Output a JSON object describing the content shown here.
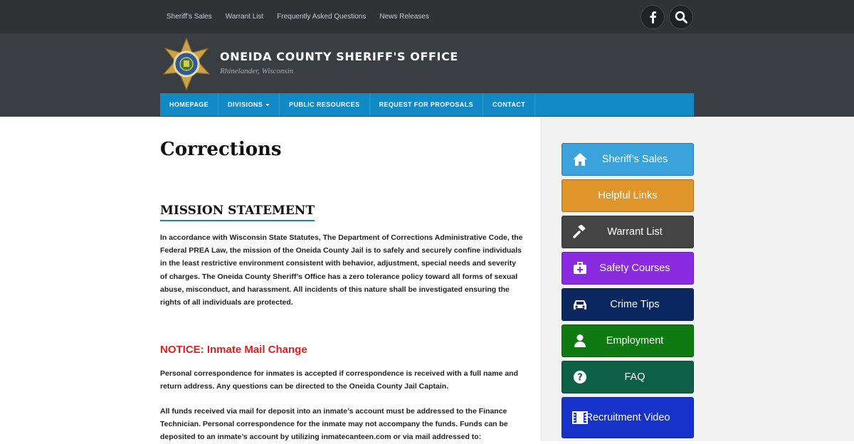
{
  "topbar": {
    "links": [
      "Sheriff’s Sales",
      "Warrant List",
      "Frequently Asked Questions",
      "News Releases"
    ],
    "icons": [
      "facebook-icon",
      "search-icon"
    ]
  },
  "header": {
    "title": "ONEIDA COUNTY SHERIFF'S OFFICE",
    "subtitle": "Rhinelander, Wisconsin",
    "logo_text": [
      "SHERIFF",
      "ONEIDA COUNTY"
    ]
  },
  "nav": {
    "items": [
      {
        "label": "HOMEPAGE"
      },
      {
        "label": "DIVISIONS"
      },
      {
        "label": "PUBLIC RESOURCES"
      },
      {
        "label": "REQUEST FOR PROPOSALS"
      },
      {
        "label": "CONTACT"
      }
    ]
  },
  "main": {
    "title": "Corrections",
    "mission_heading": "MISSION STATEMENT",
    "mission_text": "In accordance with Wisconsin State Statutes, The Department of Corrections Administrative Code, the Federal PREA Law,  the mission of the Oneida County Jail is to safely and securely confine individuals in the least restrictive environment consistent with behavior, adjustment, special needs and severity of charges. The Oneida County Sheriff’s Office has a zero tolerance policy toward all forms of sexual abuse, misconduct, and harassment.  All incidents of this nature shall be investigated ensuring the rights of all individuals are protected.",
    "notice_heading": "NOTICE: Inmate Mail Change",
    "notice_p1": "Personal correspondence for inmates is accepted if correspondence is received with a full name and return address.  Any questions can be directed to the Oneida County Jail Captain.",
    "notice_p2": "All funds received via mail for deposit into an inmate’s account must be addressed to the Finance Technician.  Personal correspondence for the inmate may not accompany the funds.  Funds can be deposited to an inmate’s account by utilizing inmatecanteen.com or via mail addressed to:"
  },
  "sidebar": {
    "buttons": [
      {
        "label": "Sheriff’s Sales",
        "icon": "home-icon",
        "color": "#3aa3dc"
      },
      {
        "label": "Helpful Links",
        "icon": "",
        "color": "#e0952a"
      },
      {
        "label": "Warrant List",
        "icon": "gavel-icon",
        "color": "#444444"
      },
      {
        "label": "Safety Courses",
        "icon": "medkit-icon",
        "color": "#8a2be2"
      },
      {
        "label": "Crime Tips",
        "icon": "car-icon",
        "color": "#0a2760"
      },
      {
        "label": "Employment",
        "icon": "user-icon",
        "color": "#0f7a11"
      },
      {
        "label": "FAQ",
        "icon": "question-icon",
        "color": "#0d5f45"
      },
      {
        "label": "Recruitment Video",
        "icon": "film-icon",
        "color": "#1632c8"
      }
    ]
  },
  "colors": {
    "topbar": "#303236",
    "header": "#3a3d42",
    "nav": "#1289c7",
    "notice": "#e0201f"
  }
}
